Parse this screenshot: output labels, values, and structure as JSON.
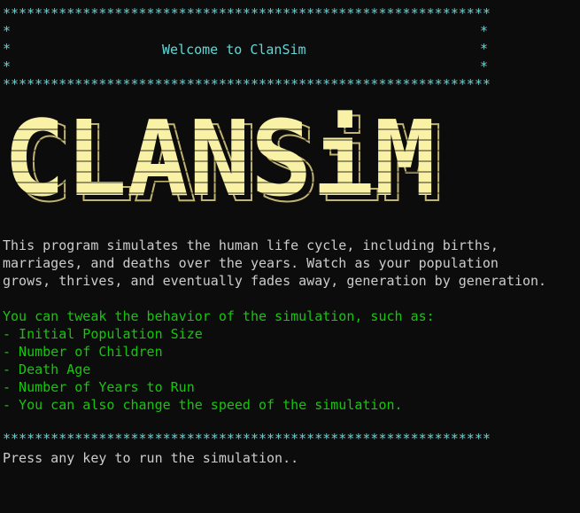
{
  "terminal": {
    "border_line": "*************************************************************",
    "side_star": "*",
    "welcome": "Welcome to ClanSim",
    "banner_text": "CLANSiM",
    "description": [
      "This program simulates the human life cycle, including births,",
      "marriages, and deaths over the years. Watch as your population",
      "grows, thrives, and eventually fades away, generation by generation."
    ],
    "options_intro": "You can tweak the behavior of the simulation, such as:",
    "options": [
      "- Initial Population Size",
      "- Number of Children",
      "- Death Age",
      "- Number of Years to Run",
      "- You can also change the speed of the simulation."
    ],
    "prompt": "Press any key to run the simulation.."
  },
  "colors": {
    "background": "#0c0c0c",
    "header": "#61d6d6",
    "body_text": "#cccccc",
    "options_text": "#16c60c",
    "banner_fill": "#f9f1a5",
    "banner_shadow": "#c1b370"
  }
}
